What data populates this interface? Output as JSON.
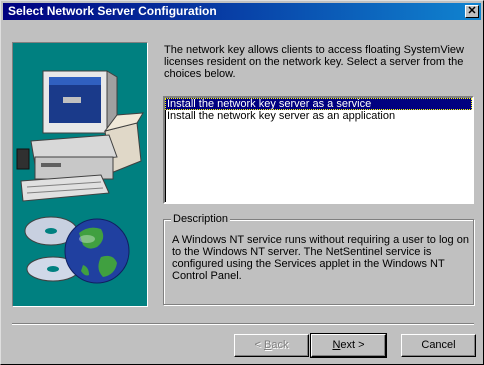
{
  "window": {
    "title": "Select Network Server Configuration",
    "close_glyph": "✕"
  },
  "intro_text": "The network key allows clients to access floating SystemView licenses resident on the network key. Select a server from the choices below.",
  "server_options": {
    "items": [
      {
        "label": "Install the network key server as a service",
        "selected": true
      },
      {
        "label": "Install the network key server as an application",
        "selected": false
      }
    ]
  },
  "description": {
    "legend": "Description",
    "text": "A Windows NT service runs without requiring a user to log on to the Windows NT server. The NetSentinel service is configured using the Services applet in the Windows NT Control Panel."
  },
  "buttons": {
    "back": {
      "prefix": "< ",
      "accel": "B",
      "rest": "ack",
      "enabled": false
    },
    "next": {
      "accel": "N",
      "rest": "ext >",
      "enabled": true
    },
    "cancel": {
      "label": "Cancel",
      "enabled": true
    }
  },
  "colors": {
    "title_start": "#000080",
    "title_end": "#1084d0",
    "face": "#c0c0c0",
    "art_background": "#008080",
    "selection": "#000080"
  }
}
